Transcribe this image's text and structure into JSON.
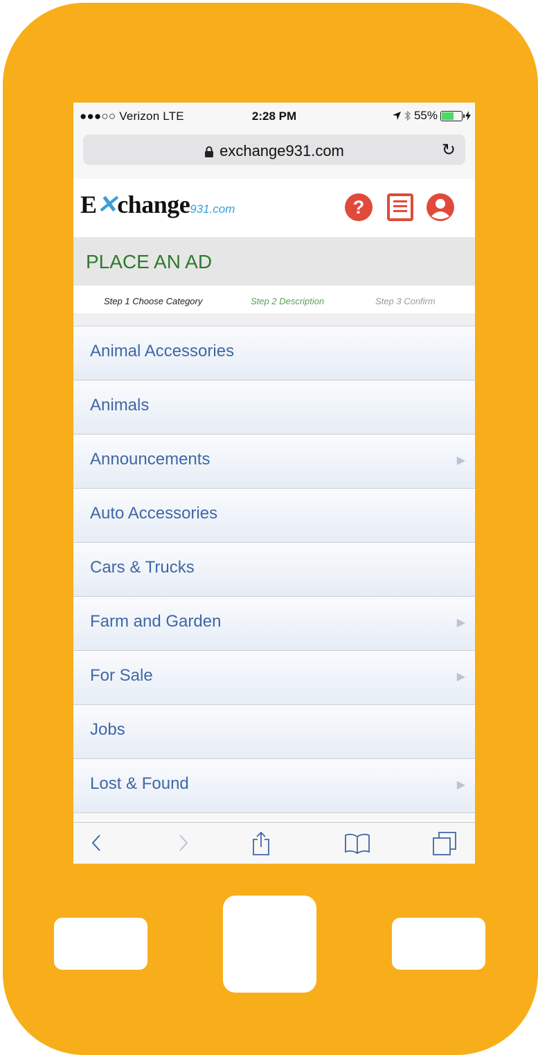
{
  "colors": {
    "phone": "#F8AE1A",
    "accent_green": "#2D7A2D",
    "link_blue": "#3F67A6",
    "icon_red": "#E04A3B"
  },
  "status_bar": {
    "carrier": "●●●○○ Verizon  LTE",
    "time": "2:28 PM",
    "battery": "55%",
    "battery_level": 0.55
  },
  "browser": {
    "url": "exchange931.com"
  },
  "site_header": {
    "logo_main": "Exchange",
    "logo_suffix": "931.com",
    "icons": [
      "help-icon",
      "list-icon",
      "account-icon"
    ]
  },
  "page": {
    "title": "PLACE AN AD",
    "steps": [
      "Step 1 Choose Category",
      "Step 2 Description",
      "Step 3 Confirm"
    ]
  },
  "categories": [
    {
      "label": "Animal Accessories",
      "has_submenu": false
    },
    {
      "label": "Animals",
      "has_submenu": false
    },
    {
      "label": "Announcements",
      "has_submenu": true
    },
    {
      "label": "Auto Accessories",
      "has_submenu": false
    },
    {
      "label": "Cars & Trucks",
      "has_submenu": false
    },
    {
      "label": "Farm and Garden",
      "has_submenu": true
    },
    {
      "label": "For Sale",
      "has_submenu": true
    },
    {
      "label": "Jobs",
      "has_submenu": false
    },
    {
      "label": "Lost & Found",
      "has_submenu": true
    }
  ],
  "toolbar_icons": [
    "back-icon",
    "forward-icon",
    "share-icon",
    "bookmarks-icon",
    "tabs-icon"
  ]
}
